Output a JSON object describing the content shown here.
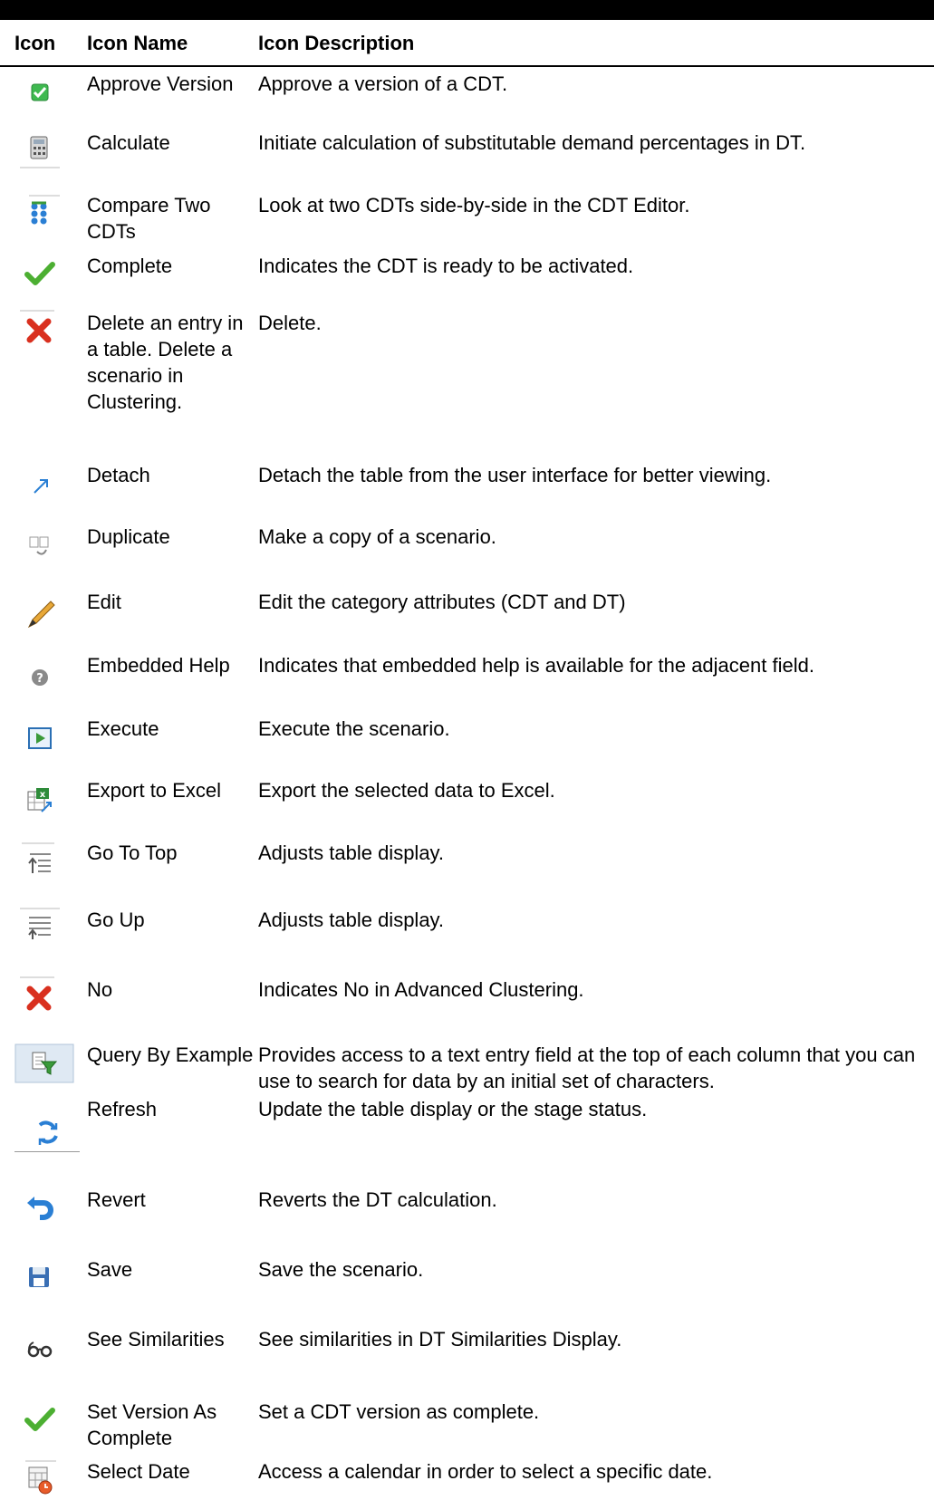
{
  "headers": {
    "icon": "Icon",
    "name": "Icon Name",
    "description": "Icon Description"
  },
  "rows": [
    {
      "icon": "approve-check-icon",
      "name": "Approve Version",
      "description": "Approve a version of a CDT."
    },
    {
      "icon": "calculator-icon",
      "name": "Calculate",
      "description": "Initiate calculation of substitutable demand percentages in DT."
    },
    {
      "icon": "compare-icon",
      "name": "Compare Two CDTs",
      "description": "Look at two CDTs side-by-side in the CDT Editor."
    },
    {
      "icon": "checkmark-icon",
      "name": "Complete",
      "description": "Indicates the CDT is ready to be activated."
    },
    {
      "icon": "red-x-icon",
      "name": "Delete an entry in a table. Delete a scenario in Clustering.",
      "description": "Delete."
    },
    {
      "icon": "detach-arrow-icon",
      "name": "Detach",
      "description": "Detach the table from the user interface for better viewing."
    },
    {
      "icon": "duplicate-icon",
      "name": "Duplicate",
      "description": "Make a copy of a scenario."
    },
    {
      "icon": "pencil-icon",
      "name": "Edit",
      "description": "Edit the category attributes (CDT and DT)"
    },
    {
      "icon": "help-question-icon",
      "name": "Embedded Help",
      "description": "Indicates that embedded help is available for the adjacent field."
    },
    {
      "icon": "execute-play-icon",
      "name": "Execute",
      "description": "Execute the scenario."
    },
    {
      "icon": "excel-export-icon",
      "name": "Export to Excel",
      "description": "Export the selected data to Excel."
    },
    {
      "icon": "go-to-top-icon",
      "name": "Go To Top",
      "description": "Adjusts table display."
    },
    {
      "icon": "go-up-icon",
      "name": "Go Up",
      "description": "Adjusts table display."
    },
    {
      "icon": "red-x-icon",
      "name": "No",
      "description": "Indicates No in Advanced Clustering."
    },
    {
      "icon": "query-filter-icon",
      "name": "Query By Example",
      "description": "Provides access to a text entry field at the top of each column that you can use to search for data by an initial set of characters."
    },
    {
      "icon": "refresh-icon",
      "name": "Refresh",
      "description": "Update the table display or the stage status."
    },
    {
      "icon": "revert-icon",
      "name": "Revert",
      "description": "Reverts the DT calculation."
    },
    {
      "icon": "save-disk-icon",
      "name": "Save",
      "description": "Save the scenario."
    },
    {
      "icon": "glasses-icon",
      "name": "See Similarities",
      "description": "See similarities in DT Similarities Display."
    },
    {
      "icon": "checkmark-icon",
      "name": "Set Version As Complete",
      "description": "Set a CDT version as complete."
    },
    {
      "icon": "calendar-clock-icon",
      "name": "Select Date",
      "description": "Access a calendar in order to select a specific date."
    }
  ]
}
